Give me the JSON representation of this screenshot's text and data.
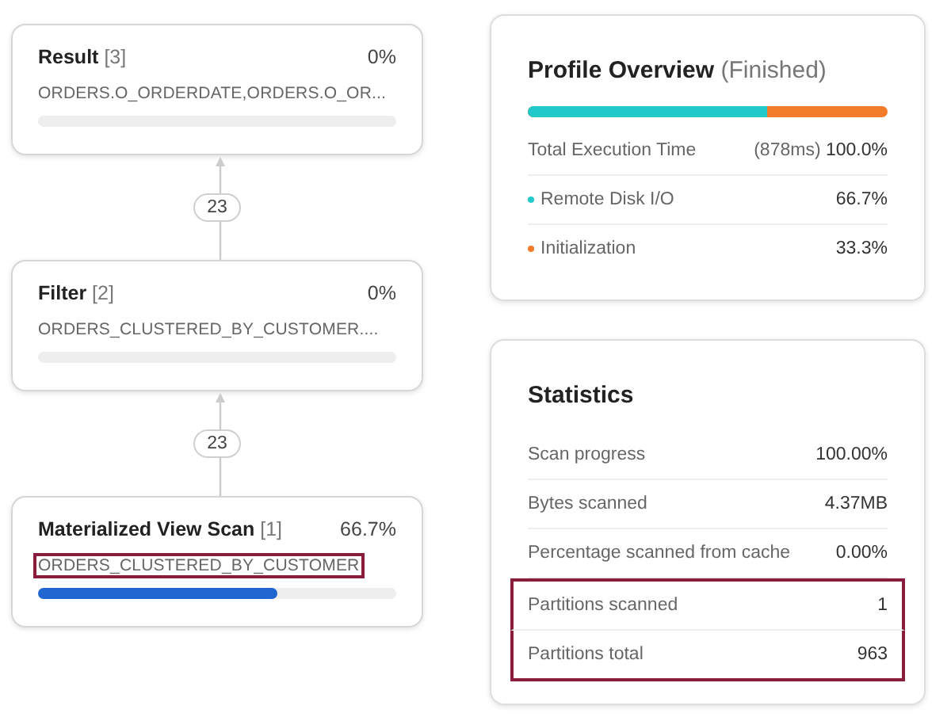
{
  "plan_nodes": [
    {
      "title": "Result",
      "index": "[3]",
      "percent": "0%",
      "detail": "ORDERS.O_ORDERDATE,ORDERS.O_OR...",
      "level": 0,
      "highlighted": false
    },
    {
      "title": "Filter",
      "index": "[2]",
      "percent": "0%",
      "detail": "ORDERS_CLUSTERED_BY_CUSTOMER....",
      "level": 0,
      "highlighted": false
    },
    {
      "title": "Materialized View Scan",
      "index": "[1]",
      "percent": "66.7%",
      "detail": "ORDERS_CLUSTERED_BY_CUSTOMER",
      "level": 0.667,
      "highlighted": true
    }
  ],
  "edges": [
    {
      "label": "23"
    },
    {
      "label": "23"
    }
  ],
  "profile_overview": {
    "title": "Profile Overview",
    "status": "(Finished)",
    "total": {
      "label": "Total Execution Time",
      "time": "(878ms)",
      "percent": "100.0%"
    },
    "bar": {
      "level": 0.667
    },
    "breakdown": [
      {
        "label": "Remote Disk I/O",
        "percent": "66.7%",
        "color": "#22c9c9"
      },
      {
        "label": "Initialization",
        "percent": "33.3%",
        "color": "#f27c2a"
      }
    ]
  },
  "statistics": {
    "title": "Statistics",
    "rows": [
      {
        "label": "Scan progress",
        "value": "100.00%",
        "highlighted": false
      },
      {
        "label": "Bytes scanned",
        "value": "4.37MB",
        "highlighted": false
      },
      {
        "label": "Percentage scanned from cache",
        "value": "0.00%",
        "highlighted": false
      },
      {
        "label": "Partitions scanned",
        "value": "1",
        "highlighted": true
      },
      {
        "label": "Partitions total",
        "value": "963",
        "highlighted": true
      }
    ]
  }
}
